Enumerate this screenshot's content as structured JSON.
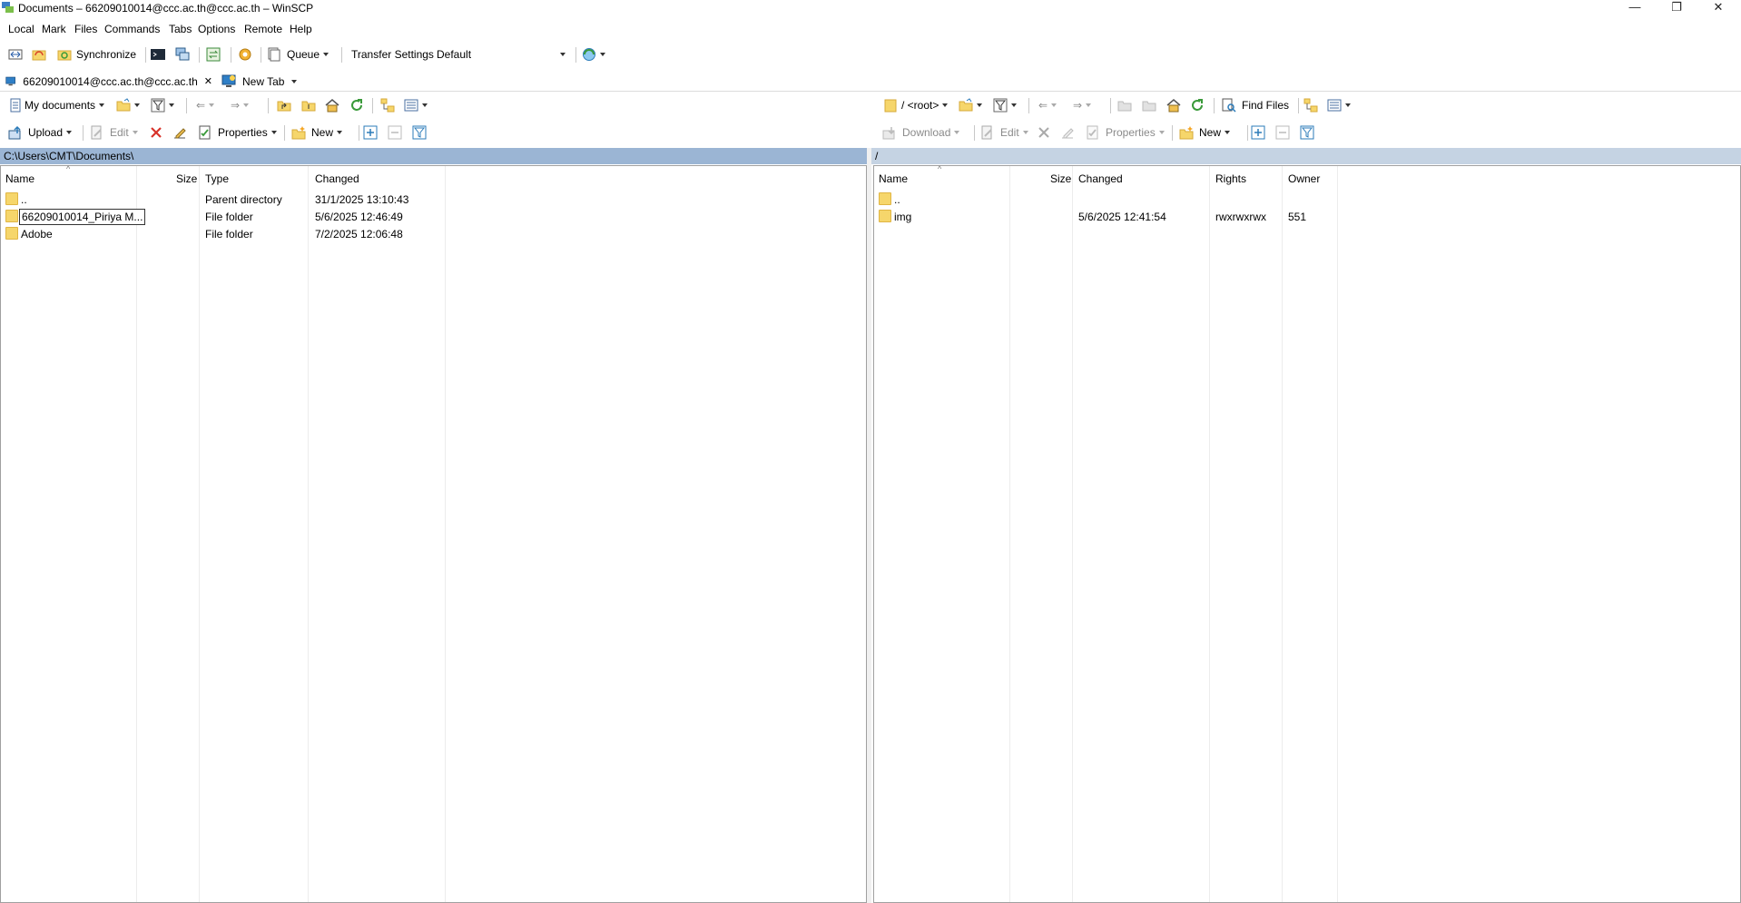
{
  "window": {
    "title": "Documents – 66209010014@ccc.ac.th@ccc.ac.th – WinSCP",
    "minimize": "—",
    "restore": "❐",
    "close": "✕"
  },
  "menu": [
    "Local",
    "Mark",
    "Files",
    "Commands",
    "Tabs",
    "Options",
    "Remote",
    "Help"
  ],
  "main_toolbar": {
    "synchronize": "Synchronize",
    "queue": "Queue",
    "transfer_settings_label": "Transfer Settings",
    "transfer_settings_value": "Default"
  },
  "tabs": [
    {
      "label": "66209010014@ccc.ac.th@ccc.ac.th",
      "close": "✕"
    },
    {
      "label": "New Tab"
    }
  ],
  "left": {
    "location": "My documents",
    "upload": "Upload",
    "edit": "Edit",
    "properties": "Properties",
    "new": "New",
    "path": "C:\\Users\\CMT\\Documents\\",
    "columns": [
      "Name",
      "Size",
      "Type",
      "Changed"
    ],
    "rows": [
      {
        "name": "..",
        "size": "",
        "type": "Parent directory",
        "changed": "31/1/2025 13:10:43",
        "icon": "parent-folder-icon"
      },
      {
        "name": "66209010014_Piriya M...",
        "size": "",
        "type": "File folder",
        "changed": "5/6/2025 12:46:49",
        "icon": "folder-icon"
      },
      {
        "name": "Adobe",
        "size": "",
        "type": "File folder",
        "changed": "7/2/2025 12:06:48",
        "icon": "folder-icon"
      }
    ]
  },
  "right": {
    "location": "/ <root>",
    "find_files": "Find Files",
    "download": "Download",
    "edit": "Edit",
    "properties": "Properties",
    "new": "New",
    "path": "/",
    "columns": [
      "Name",
      "Size",
      "Changed",
      "Rights",
      "Owner"
    ],
    "rows": [
      {
        "name": "..",
        "size": "",
        "changed": "",
        "rights": "",
        "owner": "",
        "icon": "parent-folder-icon"
      },
      {
        "name": "img",
        "size": "",
        "changed": "5/6/2025 12:41:54",
        "rights": "rwxrwxrwx",
        "owner": "551",
        "icon": "folder-icon"
      }
    ]
  },
  "colors": {
    "active_path_bg": "#9bb5d4",
    "inactive_path_bg": "#c5d3e3",
    "toolbar_bg": "#f0f0f0",
    "folder": "#f6d66b"
  }
}
